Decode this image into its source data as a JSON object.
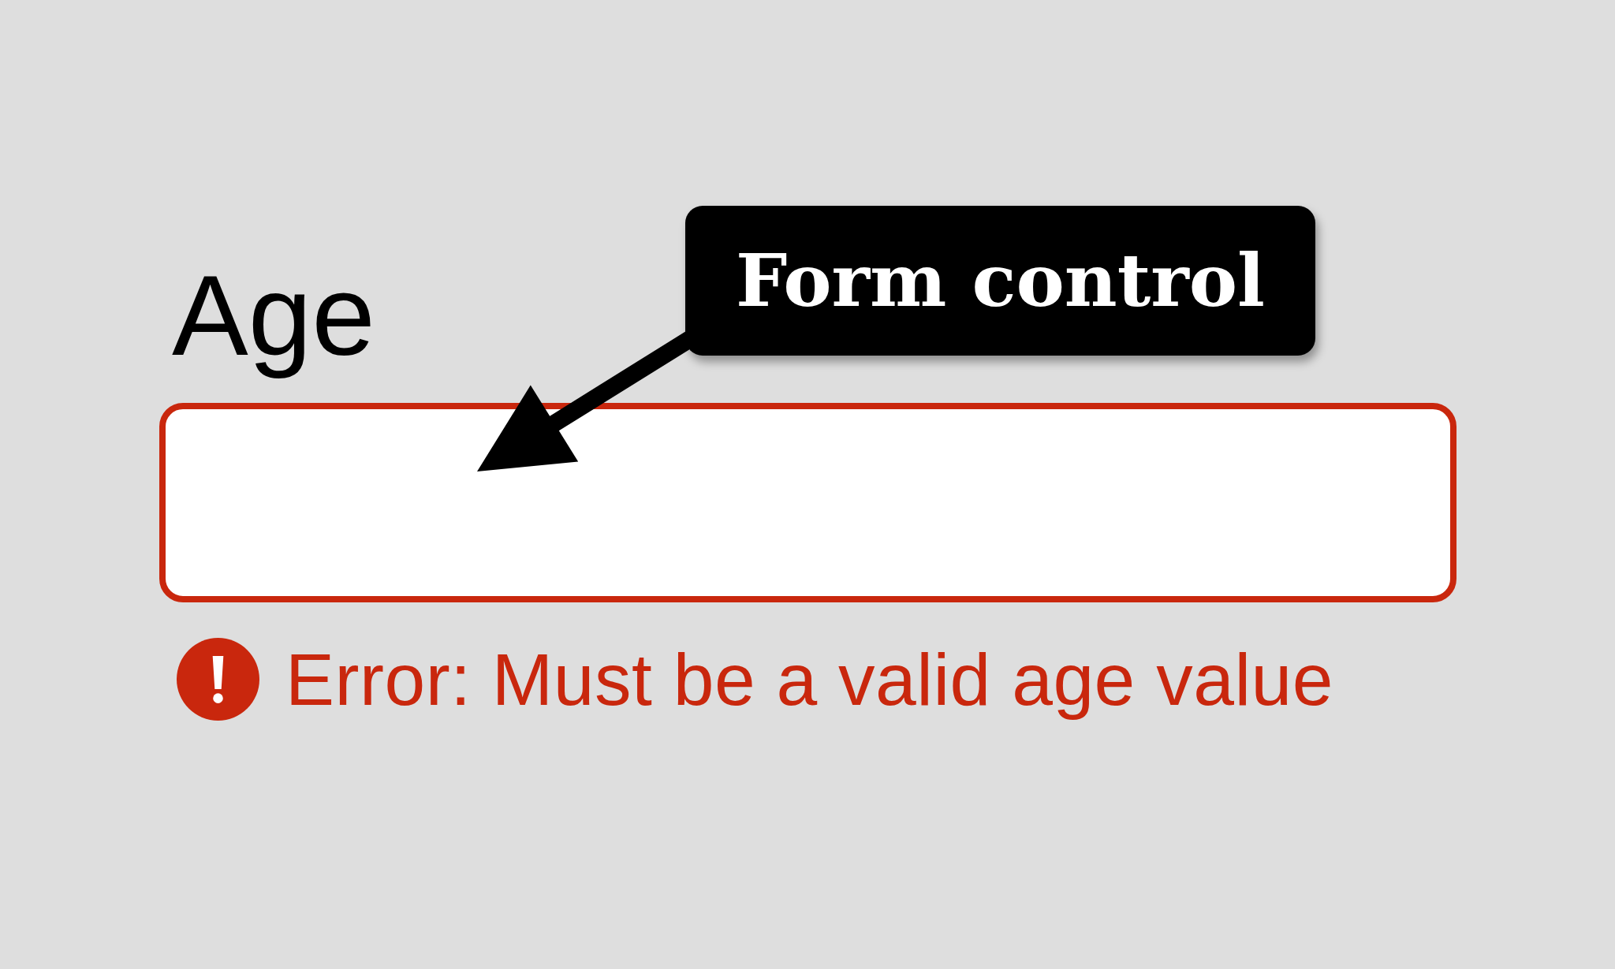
{
  "form": {
    "field": {
      "label": "Age",
      "invalid": true,
      "error": "Error: Must be a valid age value"
    }
  },
  "callout": {
    "text": "Form control"
  }
}
